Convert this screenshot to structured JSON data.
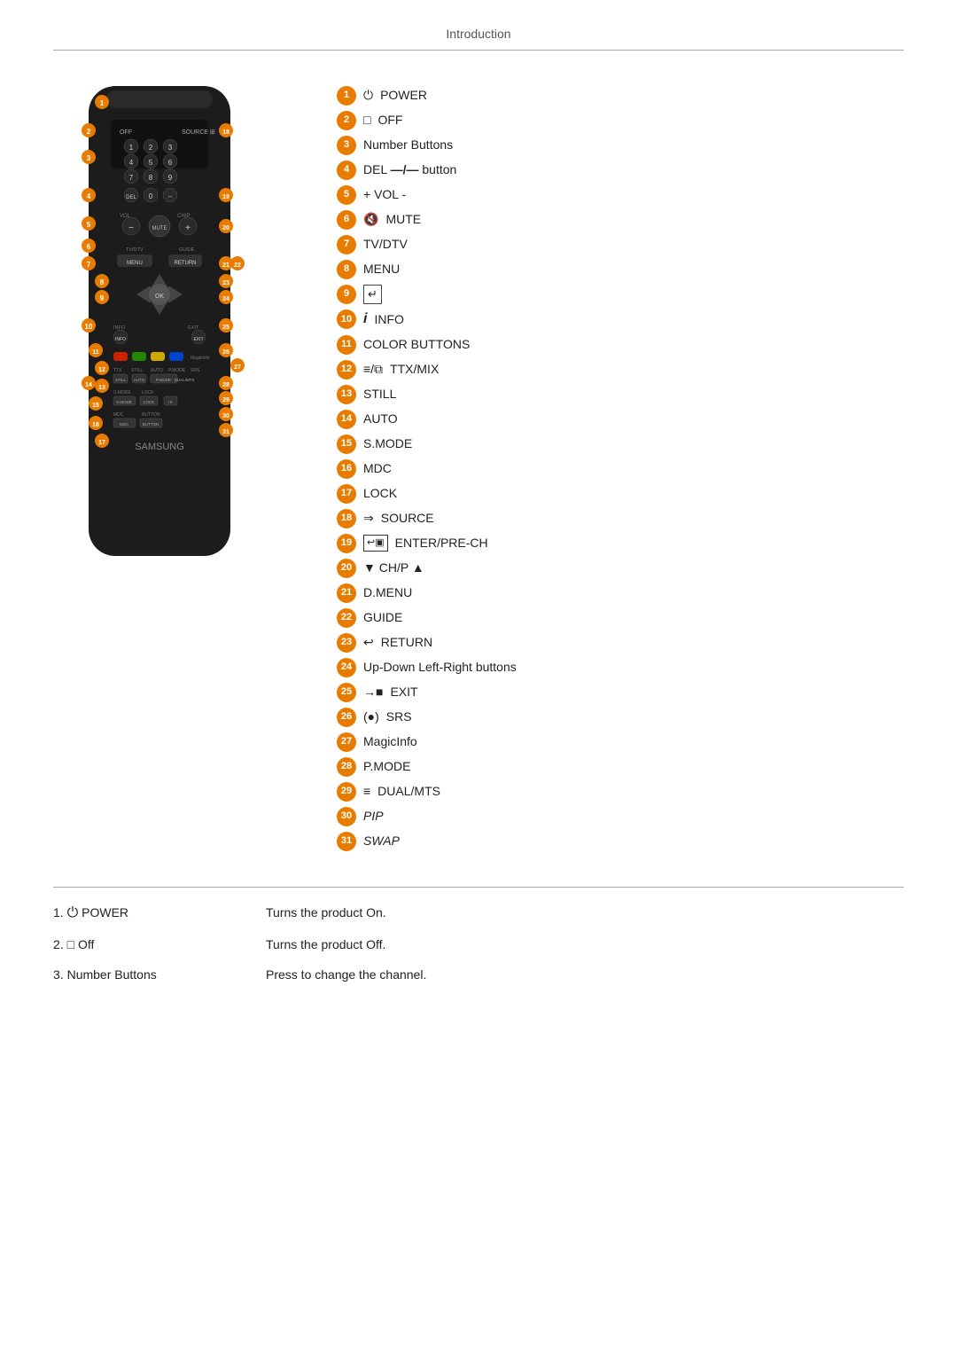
{
  "header": {
    "title": "Introduction"
  },
  "labels": [
    {
      "num": "1",
      "icon": "⏻",
      "text": "POWER"
    },
    {
      "num": "2",
      "icon": "☐",
      "text": "OFF"
    },
    {
      "num": "3",
      "icon": "",
      "text": "Number Buttons"
    },
    {
      "num": "4",
      "icon": "",
      "text": "DEL  —/—  button"
    },
    {
      "num": "5",
      "icon": "",
      "text": "+ VOL -"
    },
    {
      "num": "6",
      "icon": "🔇",
      "text": "MUTE"
    },
    {
      "num": "7",
      "icon": "",
      "text": "TV/DTV"
    },
    {
      "num": "8",
      "icon": "",
      "text": "MENU"
    },
    {
      "num": "9",
      "icon": "↵",
      "text": ""
    },
    {
      "num": "10",
      "icon": "𝑖",
      "text": "INFO"
    },
    {
      "num": "11",
      "icon": "",
      "text": "COLOR BUTTONS"
    },
    {
      "num": "12",
      "icon": "≡/⬛",
      "text": "TTX/MIX"
    },
    {
      "num": "13",
      "icon": "",
      "text": "STILL"
    },
    {
      "num": "14",
      "icon": "",
      "text": "AUTO"
    },
    {
      "num": "15",
      "icon": "",
      "text": "S.MODE"
    },
    {
      "num": "16",
      "icon": "",
      "text": "MDC"
    },
    {
      "num": "17",
      "icon": "",
      "text": "LOCK"
    },
    {
      "num": "18",
      "icon": "⇨",
      "text": "SOURCE"
    },
    {
      "num": "19",
      "icon": "⏎",
      "text": "ENTER/PRE-CH"
    },
    {
      "num": "20",
      "icon": "",
      "text": "▼ CH/P ▲"
    },
    {
      "num": "21",
      "icon": "",
      "text": "D.MENU"
    },
    {
      "num": "22",
      "icon": "",
      "text": "GUIDE"
    },
    {
      "num": "23",
      "icon": "↩",
      "text": "RETURN"
    },
    {
      "num": "24",
      "icon": "",
      "text": "Up-Down Left-Right buttons"
    },
    {
      "num": "25",
      "icon": "→☐",
      "text": "EXIT"
    },
    {
      "num": "26",
      "icon": "(●)",
      "text": "SRS"
    },
    {
      "num": "27",
      "icon": "",
      "text": "MagicInfo"
    },
    {
      "num": "28",
      "icon": "",
      "text": "P.MODE"
    },
    {
      "num": "29",
      "icon": "⊞",
      "text": "DUAL/MTS"
    },
    {
      "num": "30",
      "icon": "",
      "text": "PIP",
      "italic": true
    },
    {
      "num": "31",
      "icon": "",
      "text": "SWAP",
      "italic": true
    }
  ],
  "descriptions": [
    {
      "num": "1",
      "icon": "⏻",
      "label_text": "POWER",
      "description": "Turns the product On."
    },
    {
      "num": "2",
      "icon": "☐",
      "label_text": "Off",
      "description": "Turns the product Off."
    },
    {
      "num": "3",
      "icon": "",
      "label_text": "Number Buttons",
      "description": "Press to change the channel."
    }
  ]
}
